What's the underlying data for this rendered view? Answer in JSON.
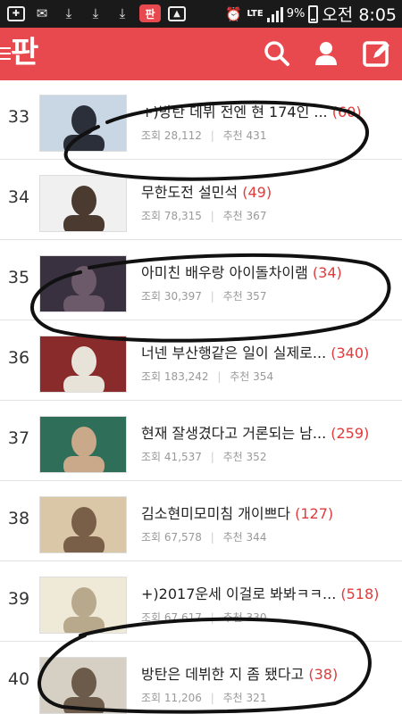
{
  "status_bar": {
    "icons": [
      "plus-icon",
      "mail-icon",
      "download-icon",
      "download-icon",
      "download-icon",
      "pann-app-icon",
      "image-icon",
      "alarm-icon"
    ],
    "network": "LTE",
    "battery": "9%",
    "time": "오전 8:05"
  },
  "header": {
    "logo": "판",
    "search_icon": "search-icon",
    "user_icon": "user-icon",
    "write_icon": "write-icon"
  },
  "list": {
    "views_label": "조회",
    "likes_label": "추천",
    "items": [
      {
        "rank": "33",
        "title": "+)방탄 데뷔 전엔 현 174인 ...",
        "comments": "(60)",
        "views": "28,112",
        "likes": "431"
      },
      {
        "rank": "34",
        "title": "무한도전 설민석",
        "comments": "(49)",
        "views": "78,315",
        "likes": "367"
      },
      {
        "rank": "35",
        "title": "아미친 배우랑 아이돌차이램",
        "comments": "(34)",
        "views": "30,397",
        "likes": "357"
      },
      {
        "rank": "36",
        "title": "너넨 부산행같은 일이 실제로...",
        "comments": "(340)",
        "views": "183,242",
        "likes": "354"
      },
      {
        "rank": "37",
        "title": "현재 잘생겼다고 거론되는 남...",
        "comments": "(259)",
        "views": "41,537",
        "likes": "352"
      },
      {
        "rank": "38",
        "title": "김소현미모미침 개이쁘다",
        "comments": "(127)",
        "views": "67,578",
        "likes": "344"
      },
      {
        "rank": "39",
        "title": "+)2017운세 이걸로 봐봐ㅋㅋ...",
        "comments": "(518)",
        "views": "67,617",
        "likes": "330"
      },
      {
        "rank": "40",
        "title": "방탄은 데뷔한 지 좀 됐다고",
        "comments": "(38)",
        "views": "11,206",
        "likes": "321"
      }
    ]
  },
  "colors": {
    "accent": "#e8494f",
    "comment_count": "#e03a3a",
    "status_bar": "#1a1a1a"
  }
}
